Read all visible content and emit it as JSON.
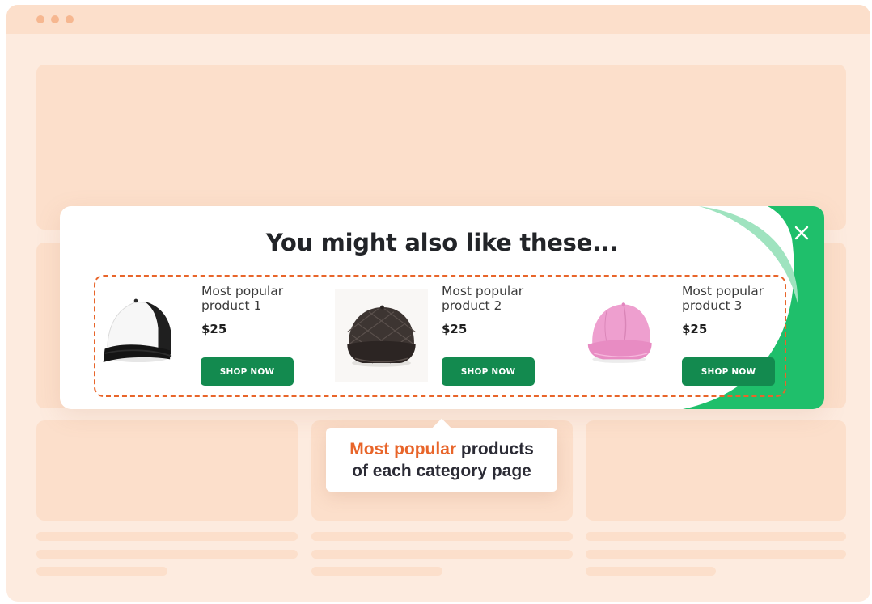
{
  "popup": {
    "title": "You might also like these...",
    "close_icon": "close-icon",
    "products": [
      {
        "name_line1": "Most popular",
        "name_line2": "product 1",
        "price": "$25",
        "button": "SHOP NOW",
        "image": "black-white-cap"
      },
      {
        "name_line1": "Most popular",
        "name_line2": "product 2",
        "price": "$25",
        "button": "SHOP NOW",
        "image": "brown-quilted-cap"
      },
      {
        "name_line1": "Most popular",
        "name_line2": "product 3",
        "price": "$25",
        "button": "SHOP NOW",
        "image": "pink-cap"
      }
    ]
  },
  "tooltip": {
    "highlight": "Most popular",
    "rest_line1": " products",
    "line2": "of each category page"
  },
  "colors": {
    "accent": "#e8652a",
    "green": "#1fbf6b",
    "button": "#138a4f",
    "background": "#fdebdf",
    "placeholder": "#fcdfcb"
  }
}
